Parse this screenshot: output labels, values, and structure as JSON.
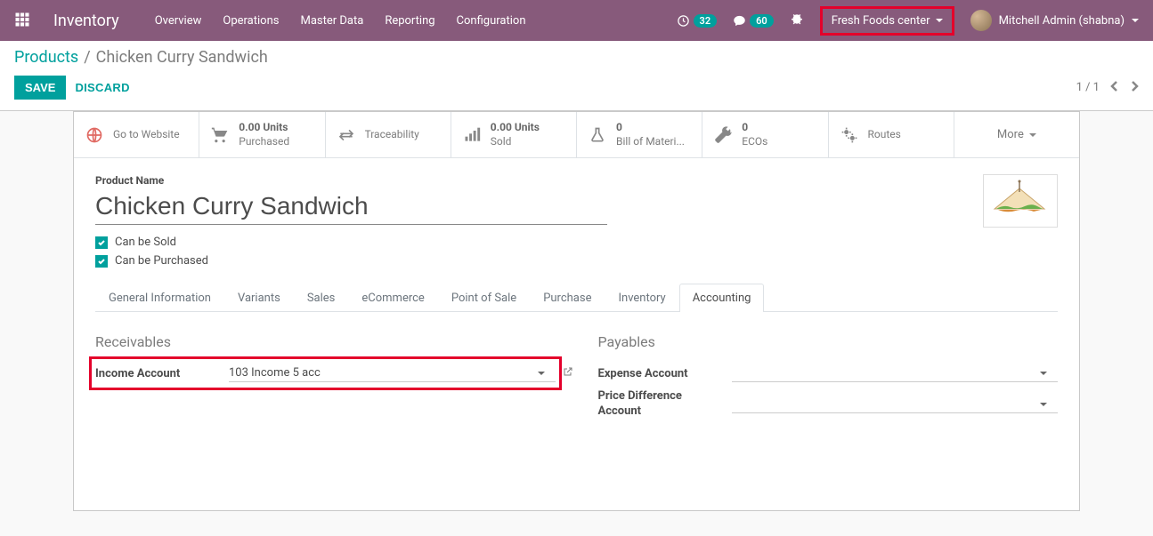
{
  "topnav": {
    "brand": "Inventory",
    "links": [
      "Overview",
      "Operations",
      "Master Data",
      "Reporting",
      "Configuration"
    ],
    "activities_count": "32",
    "messages_count": "60",
    "company": "Fresh Foods center",
    "user": "Mitchell Admin (shabna)"
  },
  "breadcrumb": {
    "root": "Products",
    "sep": "/",
    "current": "Chicken Curry Sandwich"
  },
  "buttons": {
    "save": "SAVE",
    "discard": "DISCARD"
  },
  "pager": {
    "text": "1 / 1"
  },
  "stats": {
    "website": "Go to Website",
    "purchased_val": "0.00 Units",
    "purchased_label": "Purchased",
    "traceability": "Traceability",
    "sold_val": "0.00 Units",
    "sold_label": "Sold",
    "bom_val": "0",
    "bom_label": "Bill of Materi...",
    "eco_val": "0",
    "eco_label": "ECOs",
    "routes": "Routes",
    "more": "More"
  },
  "title": {
    "product_name_label": "Product Name",
    "product_name": "Chicken Curry Sandwich",
    "can_be_sold": "Can be Sold",
    "can_be_purchased": "Can be Purchased"
  },
  "tabs": [
    "General Information",
    "Variants",
    "Sales",
    "eCommerce",
    "Point of Sale",
    "Purchase",
    "Inventory",
    "Accounting"
  ],
  "active_tab": 7,
  "accounting": {
    "receivables_title": "Receivables",
    "income_account_label": "Income Account",
    "income_account_value": "103 Income 5 acc",
    "payables_title": "Payables",
    "expense_account_label": "Expense Account",
    "expense_account_value": "",
    "price_diff_label": "Price Difference Account",
    "price_diff_value": ""
  }
}
